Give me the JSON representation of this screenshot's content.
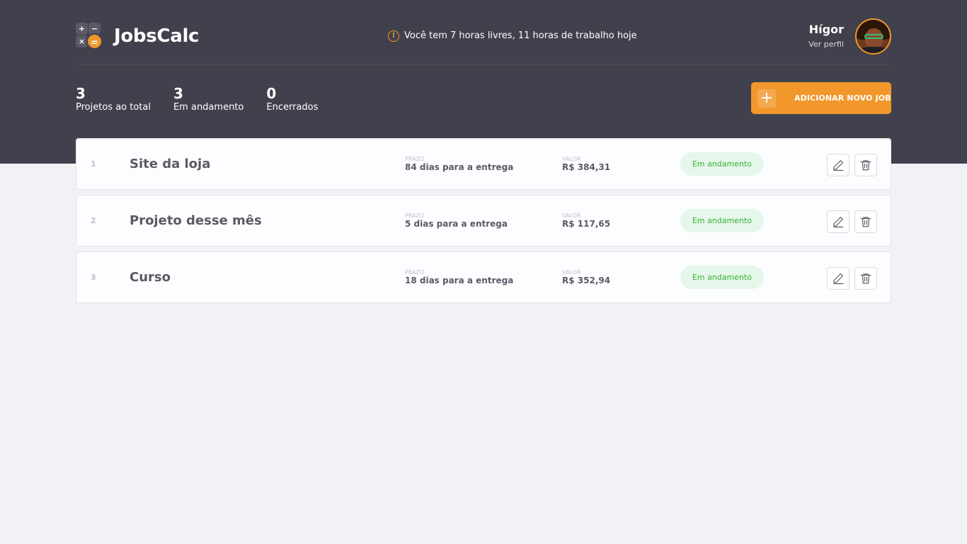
{
  "app": {
    "name": "JobsCalc",
    "logo_symbols": {
      "plus": "+",
      "minus": "−",
      "times": "×",
      "equals": "="
    }
  },
  "notice": {
    "icon": "alert-circle-icon",
    "text": "Você tem 7 horas livres, 11 horas de trabalho hoje"
  },
  "profile": {
    "name": "Hígor",
    "link": "Ver perfil"
  },
  "summary": [
    {
      "value": "3",
      "label": "Projetos ao total"
    },
    {
      "value": "3",
      "label": "Em andamento"
    },
    {
      "value": "0",
      "label": "Encerrados"
    }
  ],
  "add_button": {
    "icon": "+",
    "label": "ADICIONAR NOVO JOB"
  },
  "job_labels": {
    "deadline": "Prazo",
    "value": "Valor"
  },
  "jobs": [
    {
      "id": "1",
      "name": "Site da loja",
      "deadline": "84 dias para a entrega",
      "value": "R$ 384,31",
      "status": "Em andamento"
    },
    {
      "id": "2",
      "name": "Projeto desse mês",
      "deadline": "5 dias para a entrega",
      "value": "R$ 117,65",
      "status": "Em andamento"
    },
    {
      "id": "3",
      "name": "Curso",
      "deadline": "18 dias para a entrega",
      "value": "R$ 352,94",
      "status": "Em andamento"
    }
  ],
  "colors": {
    "header": "#41414D",
    "accent": "#F1972C",
    "status_bg": "#E5F6EA",
    "status_text": "#36B336",
    "page_bg": "#F0F2F5"
  }
}
